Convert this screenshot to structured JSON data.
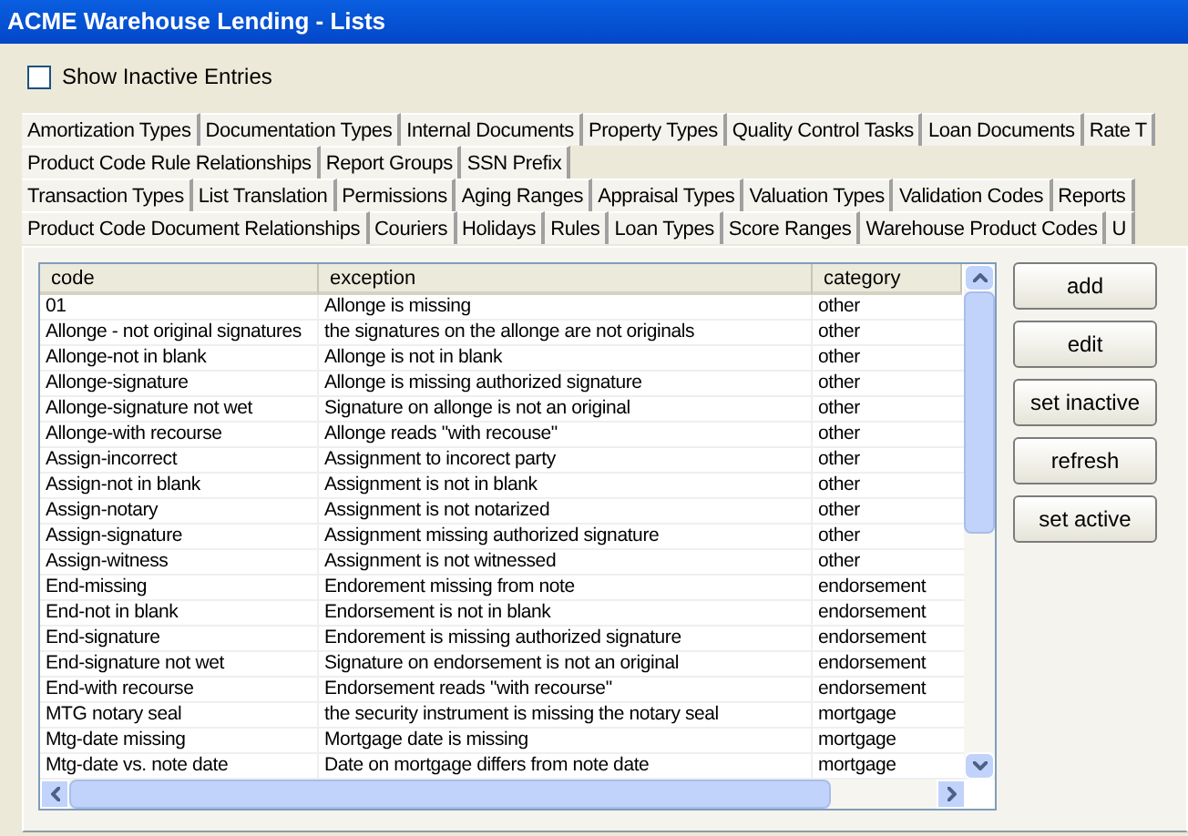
{
  "window": {
    "title": "ACME Warehouse Lending - Lists"
  },
  "show_inactive": {
    "label": "Show Inactive Entries",
    "checked": false
  },
  "tab_rows": [
    [
      "Amortization Types",
      "Documentation Types",
      "Internal Documents",
      "Property Types",
      "Quality Control Tasks",
      "Loan Documents",
      "Rate T"
    ],
    [
      "Product Code Rule Relationships",
      "Report Groups",
      "SSN Prefix"
    ],
    [
      "Transaction Types",
      "List Translation",
      "Permissions",
      "Aging Ranges",
      "Appraisal Types",
      "Valuation Types",
      "Validation Codes",
      "Reports"
    ],
    [
      "Product Code Document Relationships",
      "Couriers",
      "Holidays",
      "Rules",
      "Loan Types",
      "Score Ranges",
      "Warehouse Product Codes",
      "U"
    ]
  ],
  "table": {
    "columns": [
      "code",
      "exception",
      "category"
    ],
    "rows": [
      [
        "01",
        "Allonge is missing",
        "other"
      ],
      [
        "Allonge - not original signatures",
        "the signatures on the allonge are not originals",
        "other"
      ],
      [
        "Allonge-not in blank",
        "Allonge is not in blank",
        "other"
      ],
      [
        "Allonge-signature",
        "Allonge is missing authorized signature",
        "other"
      ],
      [
        "Allonge-signature not wet",
        "Signature on allonge is not an original",
        "other"
      ],
      [
        "Allonge-with recourse",
        "Allonge reads \"with recouse\"",
        "other"
      ],
      [
        "Assign-incorrect",
        "Assignment to incorect party",
        "other"
      ],
      [
        "Assign-not in blank",
        "Assignment is not in blank",
        "other"
      ],
      [
        "Assign-notary",
        "Assignment is not notarized",
        "other"
      ],
      [
        "Assign-signature",
        "Assignment missing authorized signature",
        "other"
      ],
      [
        "Assign-witness",
        "Assignment is not witnessed",
        "other"
      ],
      [
        "End-missing",
        "Endorement missing from note",
        "endorsement"
      ],
      [
        "End-not in blank",
        "Endorsement is not in blank",
        "endorsement"
      ],
      [
        "End-signature",
        "Endorement is missing authorized signature",
        "endorsement"
      ],
      [
        "End-signature not wet",
        "Signature on endorsement is not an original",
        "endorsement"
      ],
      [
        "End-with recourse",
        "Endorsement reads \"with recourse\"",
        "endorsement"
      ],
      [
        "MTG notary seal",
        "the security instrument is missing the notary seal",
        "mortgage"
      ],
      [
        "Mtg-date missing",
        "Mortgage date is missing",
        "mortgage"
      ],
      [
        "Mtg-date vs. note date",
        "Date on mortgage differs from note date",
        "mortgage"
      ]
    ]
  },
  "buttons": [
    "add",
    "edit",
    "set inactive",
    "refresh",
    "set active"
  ]
}
